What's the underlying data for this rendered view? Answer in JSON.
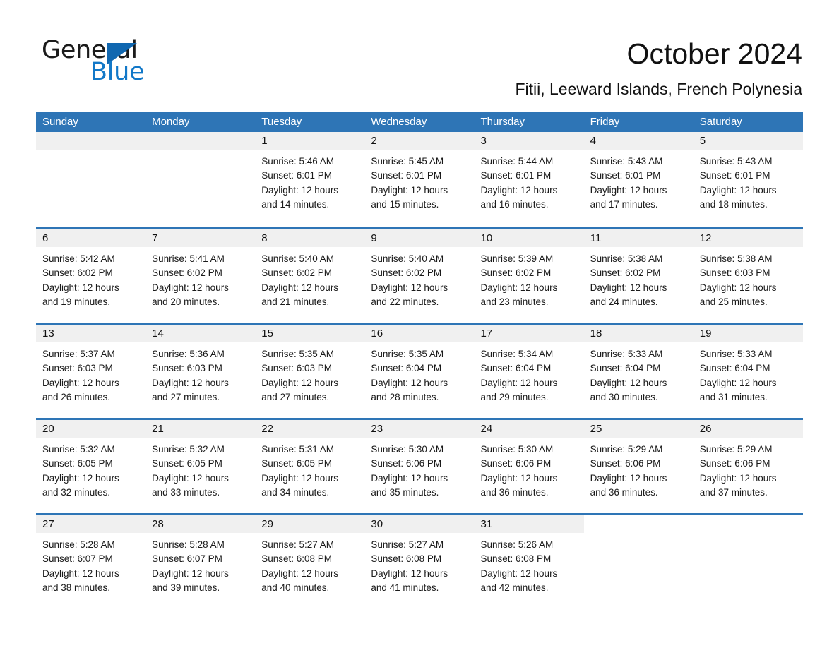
{
  "brand": {
    "name_part1": "General",
    "name_part2": "Blue",
    "triangle_color": "#1067b0",
    "blue_text_color": "#1278c8"
  },
  "header": {
    "title": "October 2024",
    "subtitle": "Fitii, Leeward Islands, French Polynesia"
  },
  "theme": {
    "header_row_color": "#2e75b6",
    "daynum_strip_color": "#f0f0f0",
    "cell_background": "#ffffff",
    "text_color": "#111111"
  },
  "weekday_headers": [
    "Sunday",
    "Monday",
    "Tuesday",
    "Wednesday",
    "Thursday",
    "Friday",
    "Saturday"
  ],
  "weeks": [
    [
      {
        "day": "",
        "sunrise": "",
        "sunset": "",
        "daylight1": "",
        "daylight2": "",
        "empty": true
      },
      {
        "day": "",
        "sunrise": "",
        "sunset": "",
        "daylight1": "",
        "daylight2": "",
        "empty": true
      },
      {
        "day": "1",
        "sunrise": "Sunrise: 5:46 AM",
        "sunset": "Sunset: 6:01 PM",
        "daylight1": "Daylight: 12 hours",
        "daylight2": "and 14 minutes."
      },
      {
        "day": "2",
        "sunrise": "Sunrise: 5:45 AM",
        "sunset": "Sunset: 6:01 PM",
        "daylight1": "Daylight: 12 hours",
        "daylight2": "and 15 minutes."
      },
      {
        "day": "3",
        "sunrise": "Sunrise: 5:44 AM",
        "sunset": "Sunset: 6:01 PM",
        "daylight1": "Daylight: 12 hours",
        "daylight2": "and 16 minutes."
      },
      {
        "day": "4",
        "sunrise": "Sunrise: 5:43 AM",
        "sunset": "Sunset: 6:01 PM",
        "daylight1": "Daylight: 12 hours",
        "daylight2": "and 17 minutes."
      },
      {
        "day": "5",
        "sunrise": "Sunrise: 5:43 AM",
        "sunset": "Sunset: 6:01 PM",
        "daylight1": "Daylight: 12 hours",
        "daylight2": "and 18 minutes."
      }
    ],
    [
      {
        "day": "6",
        "sunrise": "Sunrise: 5:42 AM",
        "sunset": "Sunset: 6:02 PM",
        "daylight1": "Daylight: 12 hours",
        "daylight2": "and 19 minutes."
      },
      {
        "day": "7",
        "sunrise": "Sunrise: 5:41 AM",
        "sunset": "Sunset: 6:02 PM",
        "daylight1": "Daylight: 12 hours",
        "daylight2": "and 20 minutes."
      },
      {
        "day": "8",
        "sunrise": "Sunrise: 5:40 AM",
        "sunset": "Sunset: 6:02 PM",
        "daylight1": "Daylight: 12 hours",
        "daylight2": "and 21 minutes."
      },
      {
        "day": "9",
        "sunrise": "Sunrise: 5:40 AM",
        "sunset": "Sunset: 6:02 PM",
        "daylight1": "Daylight: 12 hours",
        "daylight2": "and 22 minutes."
      },
      {
        "day": "10",
        "sunrise": "Sunrise: 5:39 AM",
        "sunset": "Sunset: 6:02 PM",
        "daylight1": "Daylight: 12 hours",
        "daylight2": "and 23 minutes."
      },
      {
        "day": "11",
        "sunrise": "Sunrise: 5:38 AM",
        "sunset": "Sunset: 6:02 PM",
        "daylight1": "Daylight: 12 hours",
        "daylight2": "and 24 minutes."
      },
      {
        "day": "12",
        "sunrise": "Sunrise: 5:38 AM",
        "sunset": "Sunset: 6:03 PM",
        "daylight1": "Daylight: 12 hours",
        "daylight2": "and 25 minutes."
      }
    ],
    [
      {
        "day": "13",
        "sunrise": "Sunrise: 5:37 AM",
        "sunset": "Sunset: 6:03 PM",
        "daylight1": "Daylight: 12 hours",
        "daylight2": "and 26 minutes."
      },
      {
        "day": "14",
        "sunrise": "Sunrise: 5:36 AM",
        "sunset": "Sunset: 6:03 PM",
        "daylight1": "Daylight: 12 hours",
        "daylight2": "and 27 minutes."
      },
      {
        "day": "15",
        "sunrise": "Sunrise: 5:35 AM",
        "sunset": "Sunset: 6:03 PM",
        "daylight1": "Daylight: 12 hours",
        "daylight2": "and 27 minutes."
      },
      {
        "day": "16",
        "sunrise": "Sunrise: 5:35 AM",
        "sunset": "Sunset: 6:04 PM",
        "daylight1": "Daylight: 12 hours",
        "daylight2": "and 28 minutes."
      },
      {
        "day": "17",
        "sunrise": "Sunrise: 5:34 AM",
        "sunset": "Sunset: 6:04 PM",
        "daylight1": "Daylight: 12 hours",
        "daylight2": "and 29 minutes."
      },
      {
        "day": "18",
        "sunrise": "Sunrise: 5:33 AM",
        "sunset": "Sunset: 6:04 PM",
        "daylight1": "Daylight: 12 hours",
        "daylight2": "and 30 minutes."
      },
      {
        "day": "19",
        "sunrise": "Sunrise: 5:33 AM",
        "sunset": "Sunset: 6:04 PM",
        "daylight1": "Daylight: 12 hours",
        "daylight2": "and 31 minutes."
      }
    ],
    [
      {
        "day": "20",
        "sunrise": "Sunrise: 5:32 AM",
        "sunset": "Sunset: 6:05 PM",
        "daylight1": "Daylight: 12 hours",
        "daylight2": "and 32 minutes."
      },
      {
        "day": "21",
        "sunrise": "Sunrise: 5:32 AM",
        "sunset": "Sunset: 6:05 PM",
        "daylight1": "Daylight: 12 hours",
        "daylight2": "and 33 minutes."
      },
      {
        "day": "22",
        "sunrise": "Sunrise: 5:31 AM",
        "sunset": "Sunset: 6:05 PM",
        "daylight1": "Daylight: 12 hours",
        "daylight2": "and 34 minutes."
      },
      {
        "day": "23",
        "sunrise": "Sunrise: 5:30 AM",
        "sunset": "Sunset: 6:06 PM",
        "daylight1": "Daylight: 12 hours",
        "daylight2": "and 35 minutes."
      },
      {
        "day": "24",
        "sunrise": "Sunrise: 5:30 AM",
        "sunset": "Sunset: 6:06 PM",
        "daylight1": "Daylight: 12 hours",
        "daylight2": "and 36 minutes."
      },
      {
        "day": "25",
        "sunrise": "Sunrise: 5:29 AM",
        "sunset": "Sunset: 6:06 PM",
        "daylight1": "Daylight: 12 hours",
        "daylight2": "and 36 minutes."
      },
      {
        "day": "26",
        "sunrise": "Sunrise: 5:29 AM",
        "sunset": "Sunset: 6:06 PM",
        "daylight1": "Daylight: 12 hours",
        "daylight2": "and 37 minutes."
      }
    ],
    [
      {
        "day": "27",
        "sunrise": "Sunrise: 5:28 AM",
        "sunset": "Sunset: 6:07 PM",
        "daylight1": "Daylight: 12 hours",
        "daylight2": "and 38 minutes."
      },
      {
        "day": "28",
        "sunrise": "Sunrise: 5:28 AM",
        "sunset": "Sunset: 6:07 PM",
        "daylight1": "Daylight: 12 hours",
        "daylight2": "and 39 minutes."
      },
      {
        "day": "29",
        "sunrise": "Sunrise: 5:27 AM",
        "sunset": "Sunset: 6:08 PM",
        "daylight1": "Daylight: 12 hours",
        "daylight2": "and 40 minutes."
      },
      {
        "day": "30",
        "sunrise": "Sunrise: 5:27 AM",
        "sunset": "Sunset: 6:08 PM",
        "daylight1": "Daylight: 12 hours",
        "daylight2": "and 41 minutes."
      },
      {
        "day": "31",
        "sunrise": "Sunrise: 5:26 AM",
        "sunset": "Sunset: 6:08 PM",
        "daylight1": "Daylight: 12 hours",
        "daylight2": "and 42 minutes."
      },
      {
        "day": "",
        "sunrise": "",
        "sunset": "",
        "daylight1": "",
        "daylight2": "",
        "empty": true
      },
      {
        "day": "",
        "sunrise": "",
        "sunset": "",
        "daylight1": "",
        "daylight2": "",
        "empty": true
      }
    ]
  ]
}
